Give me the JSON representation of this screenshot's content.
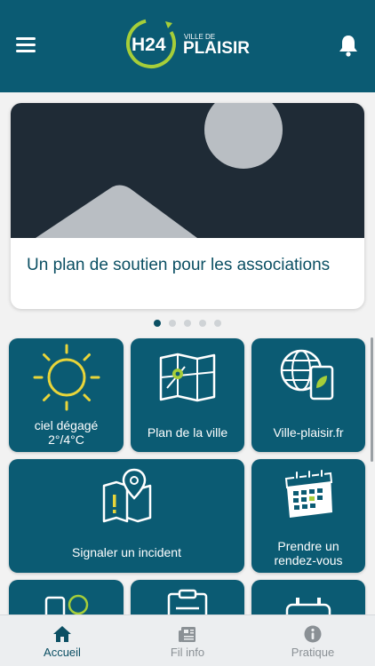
{
  "header": {
    "logo_main": "H24",
    "logo_small": "VILLE DE",
    "logo_city": "PLAISIR",
    "menu_icon": "hamburger-menu-icon",
    "notification_icon": "bell-icon"
  },
  "carousel": {
    "title": "Un plan de soutien pour les associations",
    "image_icon": "image-placeholder-icon",
    "dot_count": 5,
    "active_index": 0
  },
  "tiles": {
    "weather": {
      "line1": "ciel dégagé",
      "line2": "2°/4°C",
      "icon": "sun-icon"
    },
    "map": {
      "label": "Plan de la ville",
      "icon": "map-icon"
    },
    "website": {
      "label": "Ville-plaisir.fr",
      "icon": "globe-phone-icon"
    },
    "incident": {
      "label": "Signaler un incident",
      "icon": "map-pin-alert-icon"
    },
    "appointment": {
      "line1": "Prendre un",
      "line2": "rendez-vous",
      "icon": "calendar-icon"
    }
  },
  "tabbar": {
    "items": [
      {
        "label": "Accueil",
        "icon": "home-icon"
      },
      {
        "label": "Fil info",
        "icon": "newspaper-icon"
      },
      {
        "label": "Pratique",
        "icon": "info-icon"
      }
    ],
    "active": "Accueil"
  },
  "colors": {
    "primary": "#0b5b73",
    "accent": "#a6ce39",
    "text_dark": "#0b4f63",
    "inactive": "#8a9095"
  }
}
